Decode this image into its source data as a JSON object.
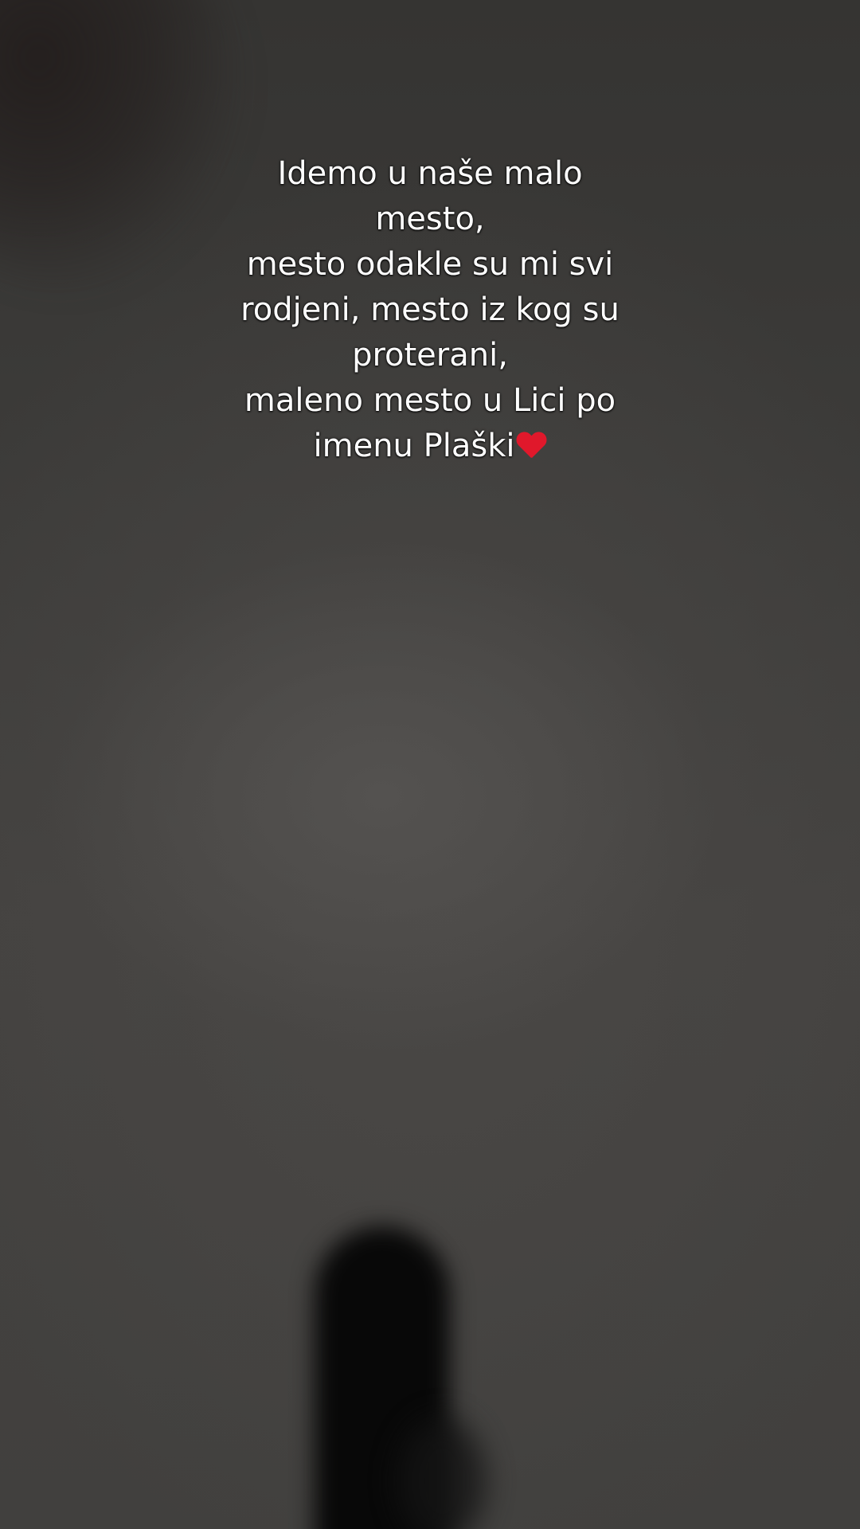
{
  "caption": {
    "lines": [
      "Idemo u naše malo",
      "mesto,",
      "mesto odakle su mi svi",
      "rodjeni, mesto iz kog su",
      "proterani,",
      "maleno mesto u Lici po",
      "imenu Plaški"
    ],
    "trailing_icon": "red-heart-emoji",
    "heart_color": "#e0182b",
    "text_color": "#ffffff"
  },
  "background": {
    "tone": "dark grey blurred floor",
    "base_color": "#3f3d3b",
    "shadow_color": "#080808"
  }
}
